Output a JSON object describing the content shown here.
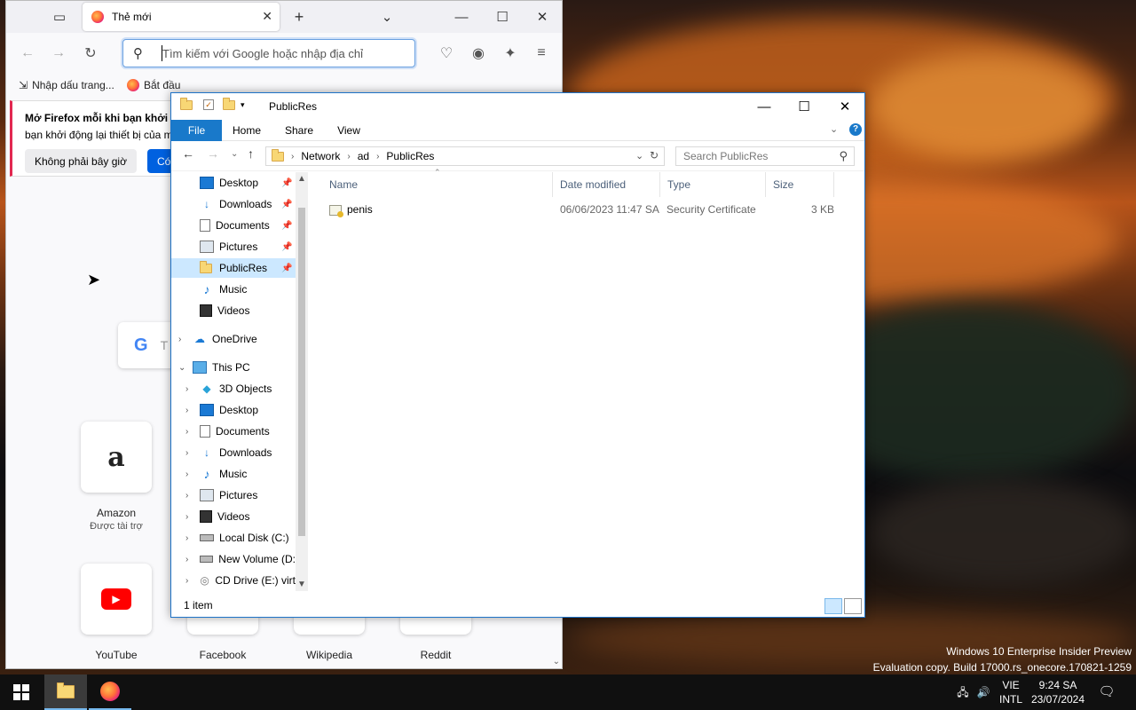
{
  "firefox": {
    "tab_title": "Thẻ mới",
    "url_placeholder": "Tìm kiếm với Google hoặc nhập địa chỉ",
    "bookmarks": [
      "Nhập dấu trang...",
      "Bắt đầu"
    ],
    "notice": {
      "heading": "Mở Firefox mỗi khi bạn khởi đ",
      "body": "bạn khởi động lại thiết bị của m",
      "btn_no": "Không phải bây giờ",
      "btn_yes": "Có,"
    },
    "search_hint": "T",
    "shortcuts": [
      {
        "name": "Amazon",
        "sub": "Được tài trợ"
      },
      {
        "name": "YouTube"
      },
      {
        "name": "Facebook"
      },
      {
        "name": "Wikipedia"
      },
      {
        "name": "Reddit"
      }
    ]
  },
  "explorer": {
    "title": "PublicRes",
    "ribbon_tabs": [
      "File",
      "Home",
      "Share",
      "View"
    ],
    "breadcrumb": [
      "Network",
      "ad",
      "PublicRes"
    ],
    "search_placeholder": "Search PublicRes",
    "nav": {
      "quick_access": [
        "Desktop",
        "Downloads",
        "Documents",
        "Pictures",
        "PublicRes",
        "Music",
        "Videos"
      ],
      "onedrive": "OneDrive",
      "this_pc": "This PC",
      "pc_items": [
        "3D Objects",
        "Desktop",
        "Documents",
        "Downloads",
        "Music",
        "Pictures",
        "Videos",
        "Local Disk (C:)",
        "New Volume (D:",
        "CD Drive (E:) virt"
      ]
    },
    "columns": [
      "Name",
      "Date modified",
      "Type",
      "Size"
    ],
    "files": [
      {
        "name": "penis",
        "date": "06/06/2023 11:47 SA",
        "type": "Security Certificate",
        "size": "3 KB"
      }
    ],
    "status": "1 item"
  },
  "watermark": {
    "line1": "Windows 10 Enterprise Insider Preview",
    "line2": "Evaluation copy. Build 17000.rs_onecore.170821-1259"
  },
  "taskbar": {
    "lang_top": "VIE",
    "lang_bottom": "INTL",
    "time": "9:24 SA",
    "date": "23/07/2024"
  }
}
